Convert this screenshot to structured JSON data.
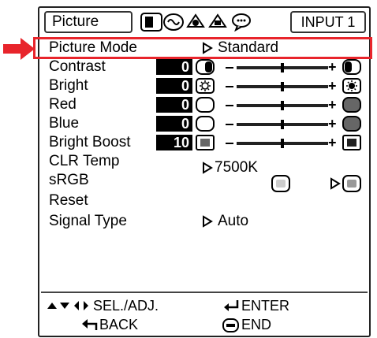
{
  "header": {
    "menu_title": "Picture",
    "input_label": "INPUT 1",
    "tab_icons": [
      "picture-tab-icon",
      "audio-tab-icon",
      "setup-tab-icon",
      "options-tab-icon",
      "language-tab-icon"
    ]
  },
  "menu": {
    "picture_mode": {
      "label": "Picture Mode",
      "value": "Standard"
    },
    "contrast": {
      "label": "Contrast",
      "value": "0"
    },
    "bright": {
      "label": "Bright",
      "value": "0"
    },
    "red": {
      "label": "Red",
      "value": "0"
    },
    "blue": {
      "label": "Blue",
      "value": "0"
    },
    "bright_boost": {
      "label": "Bright Boost",
      "value": "10"
    },
    "clr_temp": {
      "label": "CLR Temp",
      "value": "7500K"
    },
    "srgb": {
      "label": "sRGB"
    },
    "reset": {
      "label": "Reset"
    },
    "signal_type": {
      "label": "Signal Type",
      "value": "Auto"
    }
  },
  "footer": {
    "sel_adj": "SEL./ADJ.",
    "enter": "ENTER",
    "back": "BACK",
    "end": "END"
  },
  "colors": {
    "highlight": "#e8242b",
    "arrow": "#e8242b"
  }
}
